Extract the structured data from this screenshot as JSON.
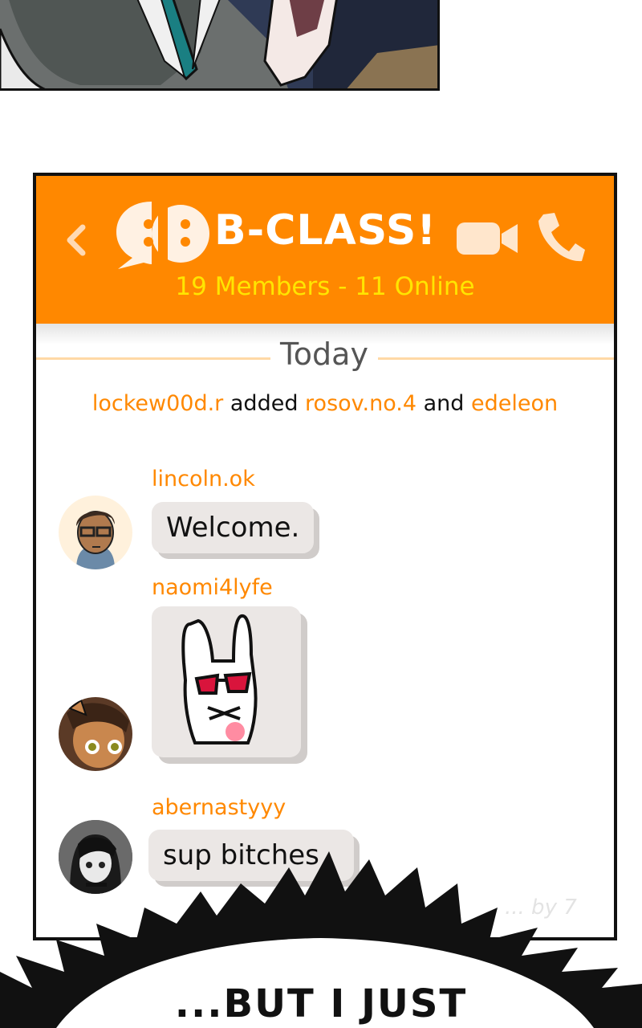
{
  "chat": {
    "back_icon": "chevron-left-icon",
    "group_icon": "group-chat-icon",
    "title": "B-CLASS!",
    "subtitle": "19 Members - 11 Online",
    "video_icon": "video-camera-icon",
    "phone_icon": "phone-icon",
    "date_label": "Today",
    "system_message": {
      "actor": "lockew00d.r",
      "verb": " added ",
      "target1": "rosov.no.4",
      "conjunction": " and ",
      "target2": "edeleon"
    },
    "messages": [
      {
        "username": "lincoln.ok",
        "text": "Welcome."
      },
      {
        "username": "naomi4lyfe",
        "sticker": "bunny-sunglasses-sticker"
      },
      {
        "username": "abernastyyy",
        "text": "sup bitches"
      }
    ],
    "watermark": "... by 7"
  },
  "caption": "...BUT I JUST",
  "colors": {
    "header": "#ff8800",
    "subtitle": "#ffe500",
    "username": "#ff8800",
    "bubble": "#ebe7e5"
  }
}
